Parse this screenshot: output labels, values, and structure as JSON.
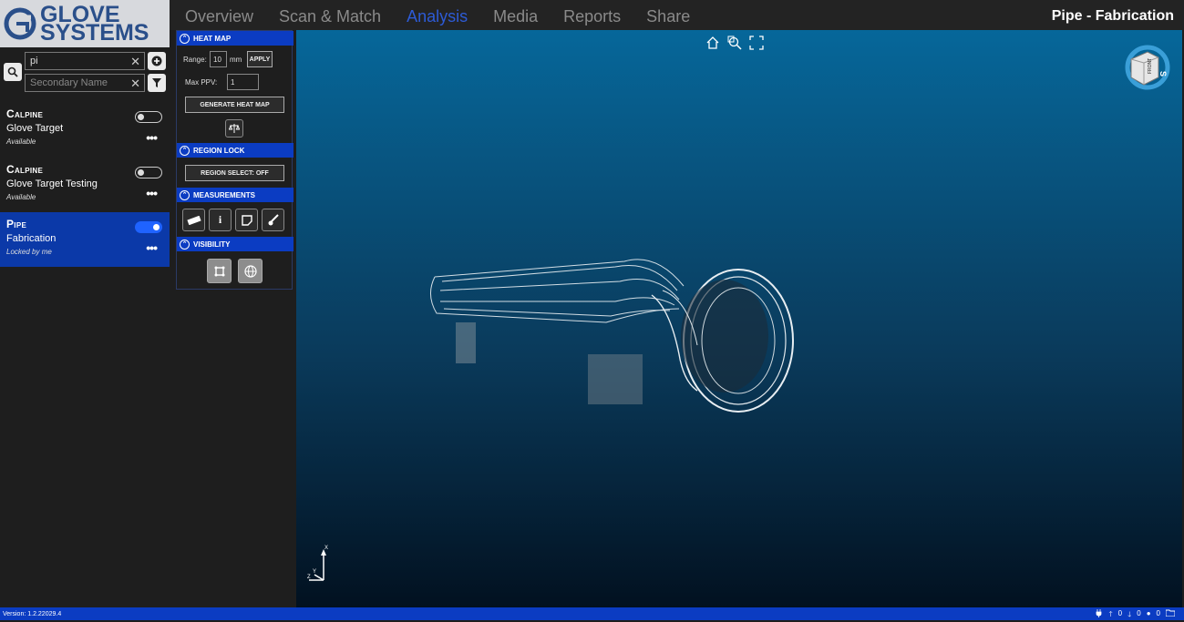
{
  "brand": {
    "logo_line1": "GLOVE",
    "logo_line2": "SYSTEMS"
  },
  "nav": {
    "items": [
      "Overview",
      "Scan & Match",
      "Analysis",
      "Media",
      "Reports",
      "Share"
    ],
    "active": "Analysis"
  },
  "page_title": "Pipe - Fabrication",
  "sidebar": {
    "search_value": "pi",
    "secondary_placeholder": "Secondary Name",
    "items": [
      {
        "name": "Calpine",
        "sub": "Glove Target",
        "status": "Available",
        "enabled": false
      },
      {
        "name": "Calpine",
        "sub": "Glove Target Testing",
        "status": "Available",
        "enabled": false
      },
      {
        "name": "Pipe",
        "sub": "Fabrication",
        "status": "Locked by me",
        "enabled": true
      }
    ]
  },
  "panel": {
    "heat_map": {
      "title": "HEAT MAP",
      "range_label": "Range:",
      "range_value": "10",
      "range_unit": "mm",
      "apply": "APPLY",
      "max_ppv_label": "Max PPV:",
      "max_ppv_value": "1",
      "generate": "GENERATE HEAT MAP"
    },
    "region_lock": {
      "title": "REGION LOCK",
      "button": "REGION SELECT: OFF"
    },
    "measurements": {
      "title": "MEASUREMENTS"
    },
    "visibility": {
      "title": "VISIBILITY"
    }
  },
  "viewport": {
    "axis_x": "X",
    "axis_z": "Z",
    "axis_y": "Y",
    "cube_front": "FRONT",
    "cube_s": "S"
  },
  "statusbar": {
    "version": "Version: 1.2.22029.4",
    "up": "0",
    "down": "0",
    "info": "0"
  },
  "colors": {
    "accent": "#0b3cc2",
    "nav_active": "#2d5bd6",
    "selected_card": "#0b39a8"
  }
}
